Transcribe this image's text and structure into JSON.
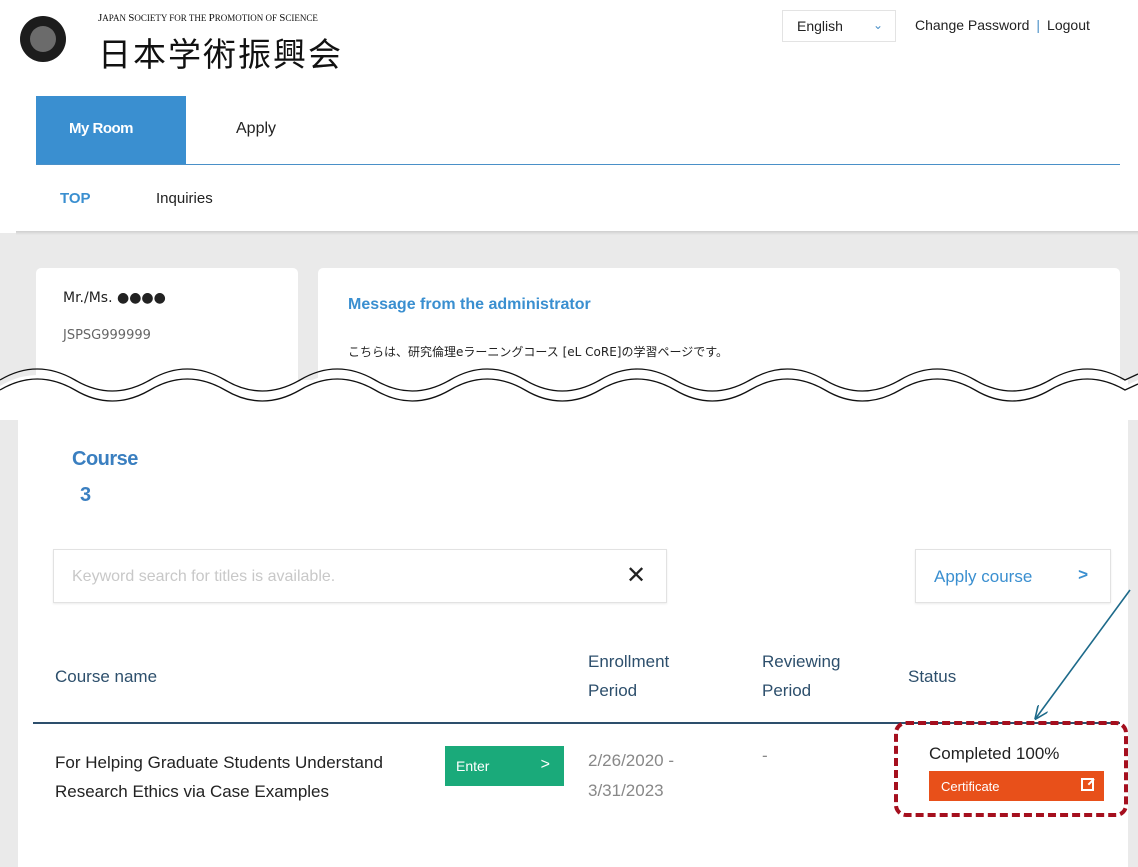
{
  "header": {
    "logo_en": "Japan Society for the Promotion of Science",
    "logo_jp": "日本学術振興会",
    "language": "English",
    "change_password": "Change Password",
    "separator": "|",
    "logout": "Logout"
  },
  "nav": {
    "tabs": [
      {
        "label": "My Room",
        "active": true
      },
      {
        "label": "Apply",
        "active": false
      }
    ],
    "sub": [
      {
        "label": "TOP",
        "active": true
      },
      {
        "label": "Inquiries",
        "active": false
      }
    ]
  },
  "user": {
    "name": "Mr./Ms. ●●●●",
    "id": "JSPSG999999"
  },
  "message": {
    "title": "Message from the administrator",
    "body": "こちらは、研究倫理eラーニングコース [eL CoRE]の学習ページです。"
  },
  "courses": {
    "title": "Course",
    "count": "3",
    "search_placeholder": "Keyword search for titles is available.",
    "clear_icon": "✕",
    "apply_label": "Apply course",
    "apply_arrow": ">",
    "headers": {
      "name": "Course name",
      "enrollment": "Enrollment Period",
      "reviewing": "Reviewing Period",
      "status": "Status"
    },
    "rows": [
      {
        "name": "For Helping Graduate Students Understand Research Ethics via Case Examples",
        "enter_label": "Enter",
        "enter_arrow": ">",
        "enrollment": "2/26/2020 - 3/31/2023",
        "reviewing": "-",
        "status": "Completed 100%",
        "certificate_label": "Certificate"
      }
    ]
  },
  "colors": {
    "accent": "#3a8fd0",
    "enter": "#1aaa7a",
    "certificate": "#e8501a",
    "highlight": "#a50f1e",
    "arrow": "#1d6a8a"
  }
}
